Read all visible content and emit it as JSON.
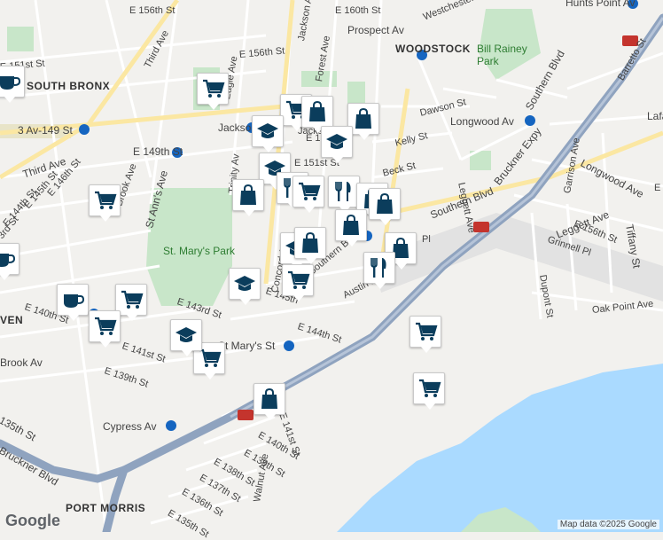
{
  "map": {
    "neighborhoods": [
      "SOUTH BRONX",
      "WOODSTOCK",
      "PORT MORRIS",
      "VEN"
    ],
    "parks": [
      "St. Mary's Park",
      "Bill Rainey Park"
    ],
    "streets": [
      "E 156th St",
      "E 160th St",
      "Prospect Av",
      "Westchester",
      "Hunts Point Av",
      "E 151st St",
      "E 156th St",
      "Third Ave",
      "Jackson Ave",
      "Forest Ave",
      "Eagle Ave",
      "3 Av-149 St",
      "Jackson",
      "Dawson St",
      "Kelly St",
      "Beck St",
      "Longwood Av",
      "E 152nd",
      "E 151st St",
      "Trinity Av",
      "E 149th St",
      "Third Ave",
      "E 146th St",
      "E 145th St",
      "E 144th St",
      "3rd St",
      "St Ann's Ave",
      "Brook Ave",
      "Concord Ave",
      "Southern Blvd",
      "Southern Blvd",
      "Leggett Ave",
      "Bruckner Expy",
      "Longwood Ave",
      "Garrison Ave",
      "E 156th St",
      "Grinnell Pl",
      "Tiffany St",
      "Leggett Ave",
      "Dupont St",
      "Oak Point Ave",
      "E 140th St",
      "E 141st St",
      "E 143rd St",
      "E 145th",
      "E 144th St",
      "St Mary's St",
      "Austin Pl",
      "Brook Av",
      "E 139th St",
      "Cypress Av",
      "135th St",
      "Bruckner Blvd",
      "E 141st St",
      "E 140th St",
      "E 139th St",
      "E 138th St",
      "E 137th St",
      "E 136th St",
      "E 135th St",
      "Walnut Ave",
      "Lafa",
      "E 1",
      "Barretto St",
      "Southern Blvd",
      "Pl",
      "Jackson Ave",
      "St"
    ],
    "highway_shields": [
      "278",
      "278",
      "278"
    ],
    "subway_markers": [
      "3 Av-149 St",
      "Jackson",
      "Longwood Av",
      "Prospect Av",
      "E 149th St",
      "St Mary's St",
      "Brook Av",
      "Cypress Av",
      "Hunts Point Av"
    ],
    "attribution": "Map data ©2025 Google",
    "logo": "Google",
    "colors": {
      "water": "#aadaff",
      "park": "#c8e6c9",
      "highway": "#8fa3bf",
      "marker_icon": "#0b3d5c",
      "street": "#ffffff"
    }
  },
  "markers": [
    {
      "type": "coffee",
      "icon": "coffee-cup-icon"
    },
    {
      "type": "grocery",
      "icon": "shopping-cart-icon"
    },
    {
      "type": "grocery",
      "icon": "shopping-cart-icon"
    },
    {
      "type": "grocery",
      "icon": "shopping-cart-icon"
    },
    {
      "type": "shopping",
      "icon": "shopping-bag-icon"
    },
    {
      "type": "shopping",
      "icon": "shopping-bag-icon"
    },
    {
      "type": "education",
      "icon": "graduation-cap-icon"
    },
    {
      "type": "education",
      "icon": "graduation-cap-icon"
    },
    {
      "type": "education",
      "icon": "graduation-cap-icon"
    },
    {
      "type": "restaurant",
      "icon": "fork-knife-icon"
    },
    {
      "type": "shopping",
      "icon": "shopping-bag-icon"
    },
    {
      "type": "grocery",
      "icon": "shopping-cart-icon"
    },
    {
      "type": "restaurant",
      "icon": "fork-knife-icon"
    },
    {
      "type": "shopping",
      "icon": "shopping-bag-icon"
    },
    {
      "type": "shopping",
      "icon": "shopping-bag-icon"
    },
    {
      "type": "shopping",
      "icon": "shopping-bag-icon"
    },
    {
      "type": "education",
      "icon": "graduation-cap-icon"
    },
    {
      "type": "shopping",
      "icon": "shopping-bag-icon"
    },
    {
      "type": "shopping",
      "icon": "shopping-bag-icon"
    },
    {
      "type": "restaurant",
      "icon": "fork-knife-icon"
    },
    {
      "type": "education",
      "icon": "graduation-cap-icon"
    },
    {
      "type": "grocery",
      "icon": "shopping-cart-icon"
    },
    {
      "type": "coffee",
      "icon": "coffee-cup-icon"
    },
    {
      "type": "coffee",
      "icon": "coffee-cup-icon"
    },
    {
      "type": "grocery",
      "icon": "shopping-cart-icon"
    },
    {
      "type": "grocery",
      "icon": "shopping-cart-icon"
    },
    {
      "type": "education",
      "icon": "graduation-cap-icon"
    },
    {
      "type": "grocery",
      "icon": "shopping-cart-icon"
    },
    {
      "type": "shopping",
      "icon": "shopping-bag-icon"
    },
    {
      "type": "grocery",
      "icon": "shopping-cart-icon"
    },
    {
      "type": "grocery",
      "icon": "shopping-cart-icon"
    }
  ]
}
